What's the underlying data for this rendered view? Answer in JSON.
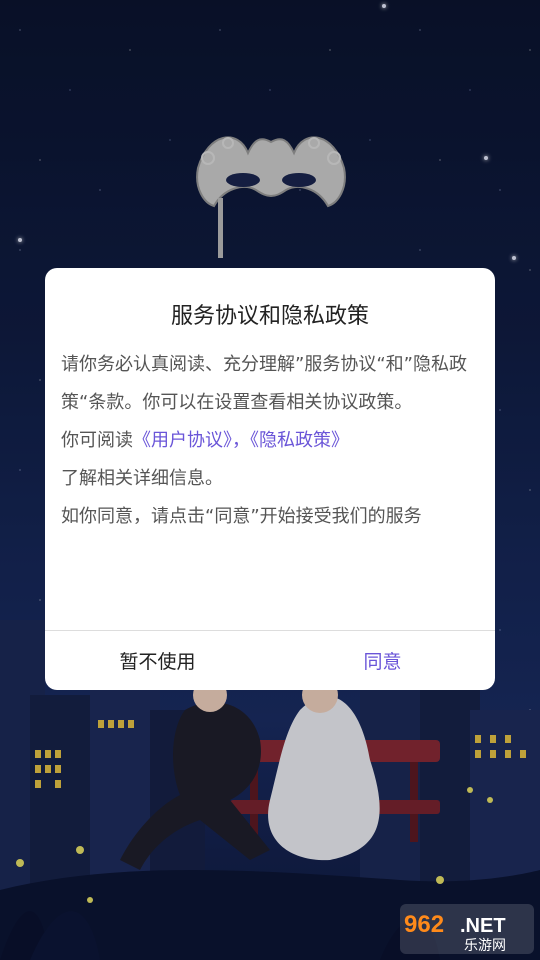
{
  "dialog": {
    "title": "服务协议和隐私政策",
    "line1": "请你务必认真阅读、充分理解”服务协议“和”隐私政策“条款。你可以在设置查看相关协议政策。",
    "line2_prefix": "你可阅读",
    "link_user_agreement": "《用户协议》",
    "link_separator": "，",
    "link_privacy_policy": "《隐私政策》",
    "line3": "了解相关详细信息。",
    "line4": "如你同意，请点击“同意”开始接受我们的服务",
    "decline_label": "暂不使用",
    "agree_label": "同意"
  },
  "watermark": {
    "brand_number": "962",
    "brand_suffix": ".NET",
    "brand_cn": "乐游网"
  },
  "colors": {
    "accent": "#6a55d8",
    "dialog_bg": "#ffffff",
    "title_text": "#222222",
    "body_text": "#555555"
  }
}
